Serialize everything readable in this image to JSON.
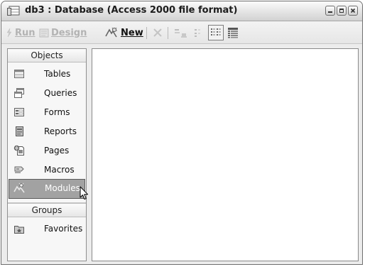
{
  "window": {
    "title": "db3 : Database (Access 2000 file format)",
    "icon": "database-window-icon",
    "controls": [
      "minimize-icon",
      "restore-icon",
      "close-icon"
    ]
  },
  "toolbar": {
    "run_label": "Run",
    "design_label": "Design",
    "new_label": "New",
    "run_enabled": false,
    "design_enabled": false,
    "new_enabled": true,
    "icons": [
      "delete-icon",
      "large-icons-icon",
      "small-icons-icon",
      "list-icon",
      "details-icon"
    ],
    "active_view": "list"
  },
  "nav": {
    "objects_header": "Objects",
    "groups_header": "Groups",
    "items": [
      {
        "label": "Tables",
        "icon": "table-icon"
      },
      {
        "label": "Queries",
        "icon": "query-icon"
      },
      {
        "label": "Forms",
        "icon": "form-icon"
      },
      {
        "label": "Reports",
        "icon": "report-icon"
      },
      {
        "label": "Pages",
        "icon": "page-icon"
      },
      {
        "label": "Macros",
        "icon": "macro-icon"
      },
      {
        "label": "Modules",
        "icon": "module-icon"
      }
    ],
    "selected": "Modules",
    "groups": [
      {
        "label": "Favorites",
        "icon": "favorites-icon"
      }
    ]
  },
  "content": {
    "items": []
  },
  "colors": {
    "selected_bg": "#a2a2a2",
    "disabled_text": "#b3b3b3"
  }
}
